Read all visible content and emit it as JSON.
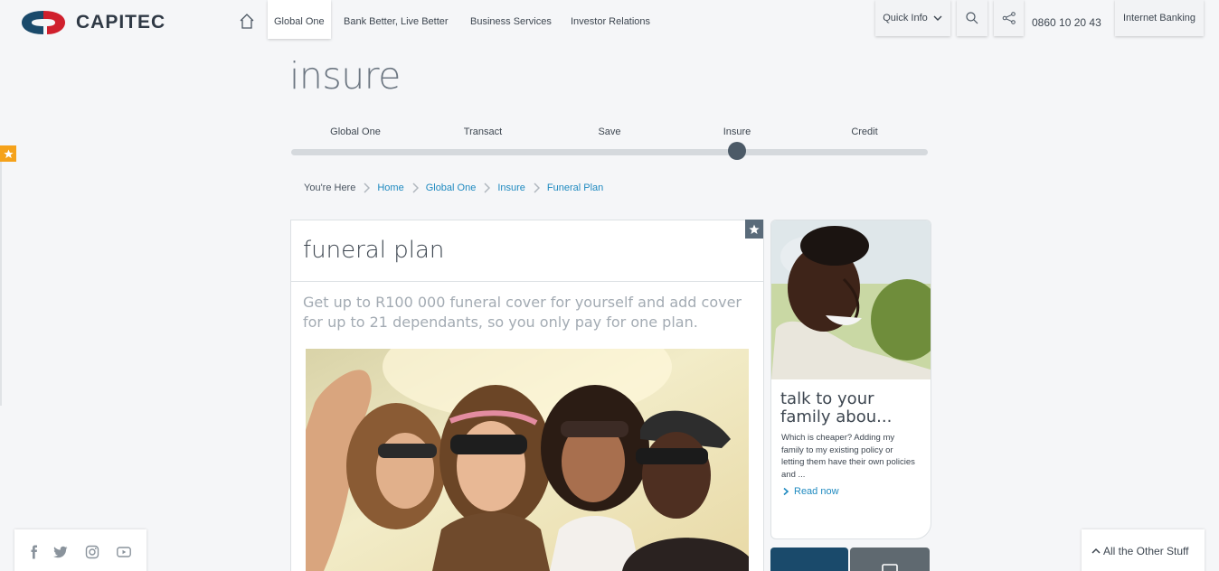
{
  "header": {
    "brand": "CAPITEC",
    "nav": [
      "Global One",
      "Bank Better, Live Better",
      "Business Services",
      "Investor Relations"
    ],
    "quick_info": "Quick Info",
    "phone": "0860 10 20 43",
    "internet_banking": "Internet Banking"
  },
  "page": {
    "title": "insure"
  },
  "steps": {
    "items": [
      "Global One",
      "Transact",
      "Save",
      "Insure",
      "Credit"
    ],
    "active_index": 3
  },
  "breadcrumb": {
    "here": "You're Here",
    "items": [
      "Home",
      "Global One",
      "Insure",
      "Funeral Plan"
    ]
  },
  "main_card": {
    "title": "funeral plan",
    "intro": "Get up to R100 000 funeral cover for yourself and add cover for up to 21 dependants, so you only pay for one plan."
  },
  "side_card": {
    "title": "talk to your family abou...",
    "text": "Which is cheaper? Adding my family to my existing policy or letting them have their own policies and ...",
    "link": "Read now"
  },
  "footer": {
    "social_icons": [
      "facebook-icon",
      "twitter-icon",
      "instagram-icon",
      "youtube-icon"
    ],
    "other_stuff": "All the Other Stuff"
  },
  "colors": {
    "brand_red": "#d0202d",
    "brand_blue": "#1a4a6b",
    "link": "#1f8ac0",
    "favourite": "#f5a21b"
  }
}
